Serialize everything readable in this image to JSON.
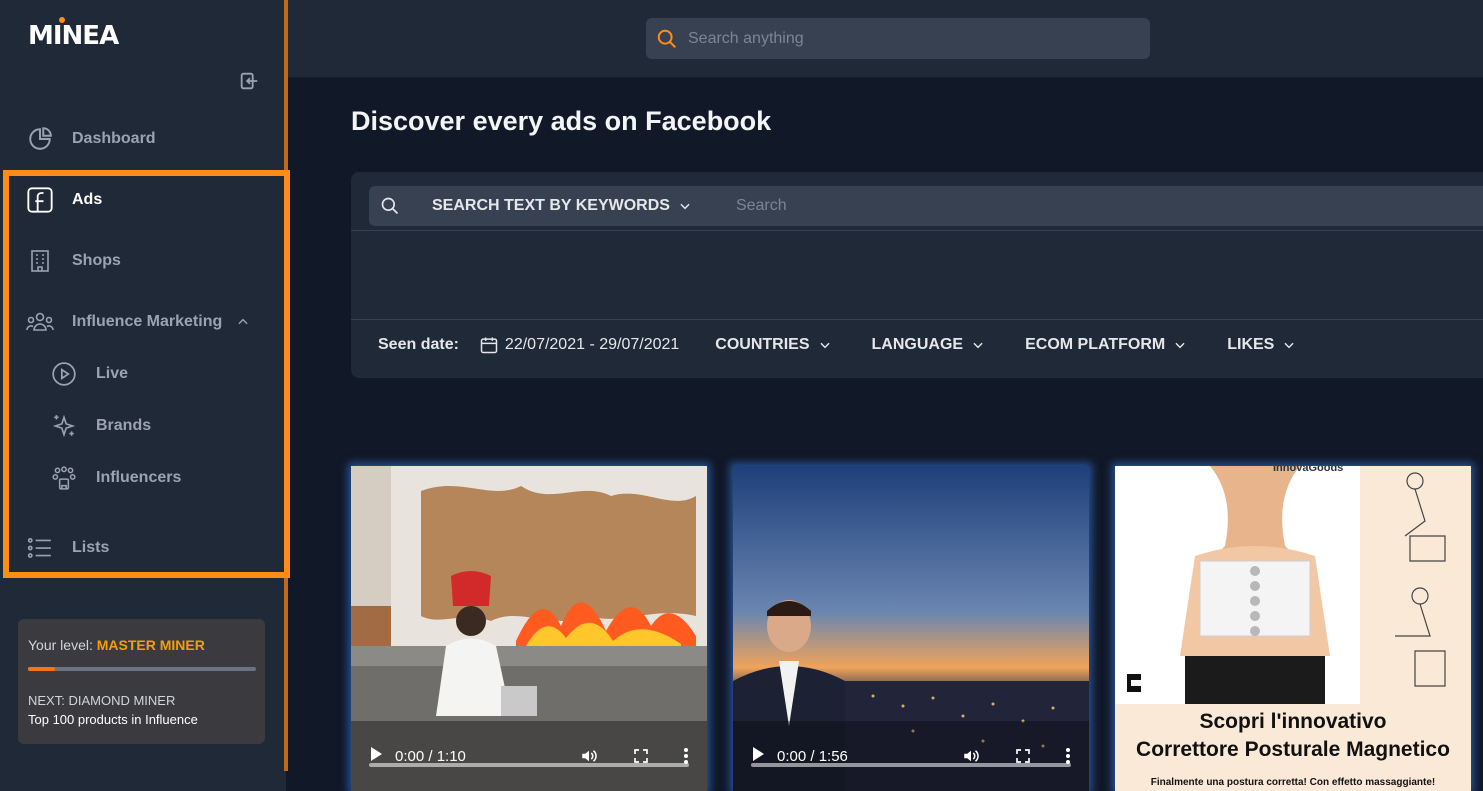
{
  "app": {
    "logo_text": "MINEA"
  },
  "search": {
    "placeholder": "Search anything"
  },
  "sidebar": {
    "items": [
      {
        "label": "Dashboard",
        "icon": "pie-chart-icon"
      },
      {
        "label": "Ads",
        "icon": "facebook-icon"
      },
      {
        "label": "Shops",
        "icon": "building-icon"
      },
      {
        "label": "Influence Marketing",
        "icon": "users-group-icon"
      },
      {
        "label": "Live",
        "icon": "play-circle-icon"
      },
      {
        "label": "Brands",
        "icon": "sparkles-icon"
      },
      {
        "label": "Influencers",
        "icon": "influencers-icon"
      },
      {
        "label": "Lists",
        "icon": "list-icon"
      }
    ],
    "level": {
      "label": "Your level:",
      "value": "MASTER MINER",
      "progress": 0.12,
      "next": "NEXT: DIAMOND MINER",
      "next_sub": "Top 100 products in Influence"
    }
  },
  "main": {
    "title": "Discover every ads on Facebook",
    "keyword": {
      "mode": "SEARCH TEXT BY KEYWORDS",
      "placeholder": "Search"
    },
    "filters": {
      "seen_label": "Seen date:",
      "date_range": "22/07/2021 - 29/07/2021",
      "dropdowns": [
        "COUNTRIES",
        "LANGUAGE",
        "ECOM PLATFORM",
        "LIKES"
      ]
    },
    "ads": [
      {
        "time": "0:00 / 1:10"
      },
      {
        "time": "0:00 / 1:56"
      },
      {
        "brand": "InnovaGoods",
        "headline_1": "Scopri l'innovativo",
        "headline_2": "Correttore Posturale Magnetico",
        "small": "Finalmente una postura corretta! Con effetto massaggiante!"
      }
    ]
  },
  "colors": {
    "accent": "#ff8c16",
    "sidebar_bg": "#1f2937",
    "page_bg": "#111827",
    "level_value": "#f59e0b"
  }
}
